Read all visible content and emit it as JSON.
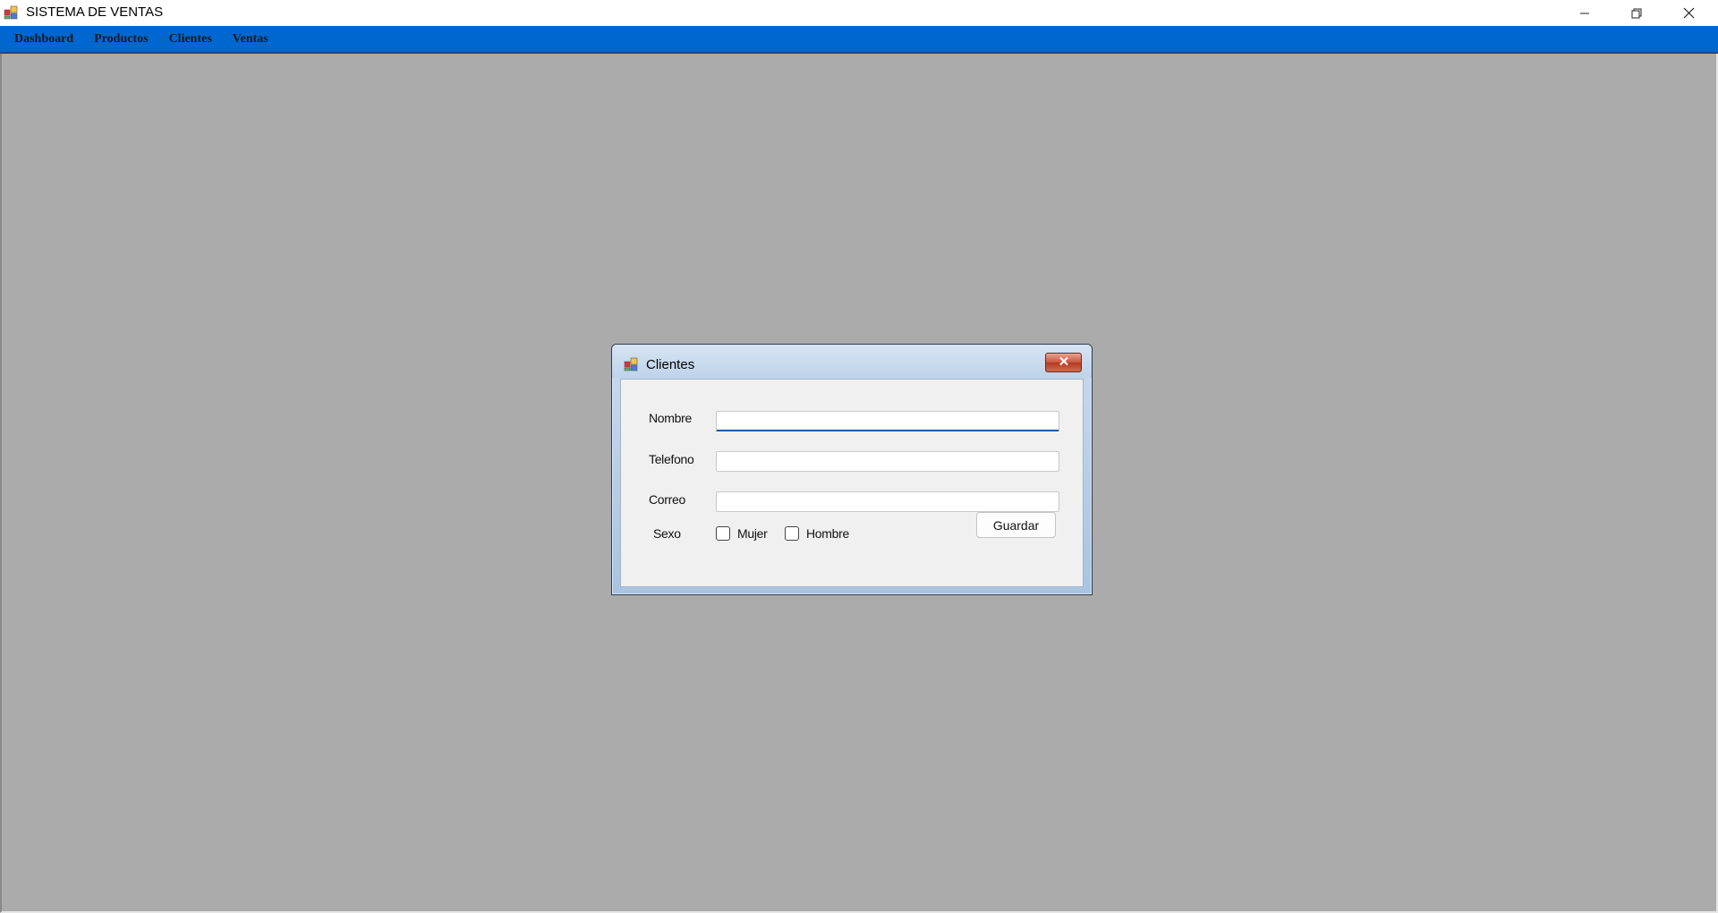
{
  "window": {
    "title": "SISTEMA DE VENTAS",
    "controls": [
      "minimize-icon",
      "restore-icon",
      "close-icon"
    ]
  },
  "menu": {
    "items": [
      {
        "label": "Dashboard"
      },
      {
        "label": "Productos"
      },
      {
        "label": "Clientes"
      },
      {
        "label": "Ventas"
      }
    ]
  },
  "dialog": {
    "title": "Clientes",
    "fields": {
      "nombre": {
        "label": "Nombre",
        "value": ""
      },
      "telefono": {
        "label": "Telefono",
        "value": ""
      },
      "correo": {
        "label": "Correo",
        "value": ""
      }
    },
    "sexo": {
      "label": "Sexo",
      "options": [
        {
          "label": "Mujer",
          "checked": false
        },
        {
          "label": "Hombre",
          "checked": false
        }
      ]
    },
    "save_label": "Guardar"
  },
  "colors": {
    "menubar": "#0067d0",
    "mdi_background": "#ababab",
    "dialog_frame": "#bed3ea",
    "dialog_close": "#c8553c"
  }
}
